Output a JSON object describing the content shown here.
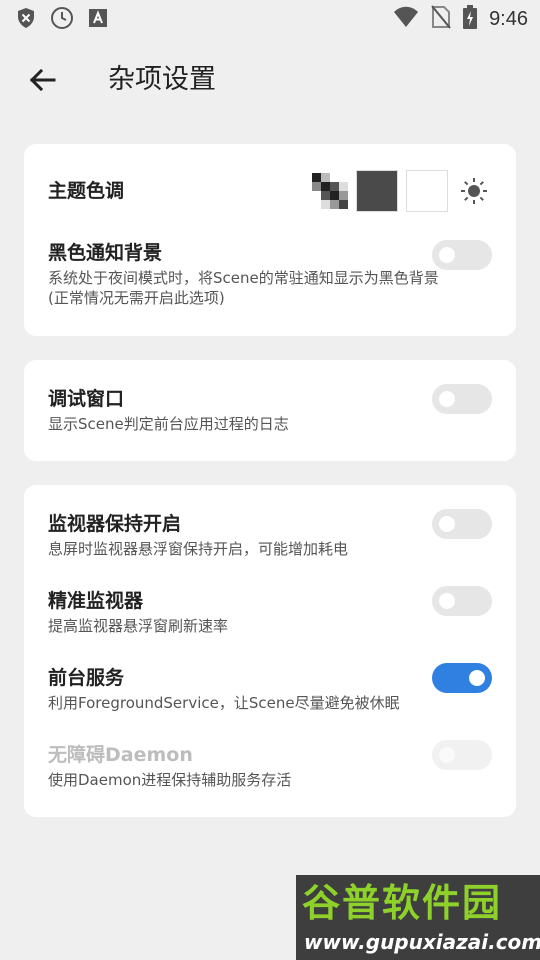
{
  "status_bar": {
    "time": "9:46",
    "left_icons": [
      "shield-icon",
      "clock-icon",
      "font-a-icon"
    ],
    "right_icons": [
      "wifi-icon",
      "no-sim-icon",
      "battery-charging-icon"
    ]
  },
  "app_bar": {
    "back_icon": "arrow-left-icon",
    "title": "杂项设置"
  },
  "theme": {
    "title": "主题色调",
    "options": [
      "checker-pattern",
      "dark",
      "light",
      "sun-icon"
    ]
  },
  "black_notification": {
    "title": "黑色通知背景",
    "desc_line1": "系统处于夜间模式时，将Scene的常驻通知显示为黑色背景",
    "desc_line2": "(正常情况无需开启此选项)",
    "on": false
  },
  "debug_window": {
    "title": "调试窗口",
    "desc": "显示Scene判定前台应用过程的日志",
    "on": false
  },
  "monitor_keep": {
    "title": "监视器保持开启",
    "desc": "息屏时监视器悬浮窗保持开启，可能增加耗电",
    "on": false
  },
  "precise_monitor": {
    "title": "精准监视器",
    "desc": "提高监视器悬浮窗刷新速率",
    "on": false
  },
  "foreground_service": {
    "title": "前台服务",
    "desc": "利用ForegroundService，让Scene尽量避免被休眠",
    "on": true
  },
  "accessibility_daemon": {
    "title": "无障碍Daemon",
    "desc": "使用Daemon进程保持辅助服务存活",
    "on": false,
    "disabled": true
  },
  "watermark": {
    "title": "谷普软件园",
    "url": "www.gupuxiazai.com"
  },
  "colors": {
    "accent": "#2f80e0",
    "background": "#efefef",
    "card": "#ffffff",
    "watermark_green": "#8dd12a"
  }
}
